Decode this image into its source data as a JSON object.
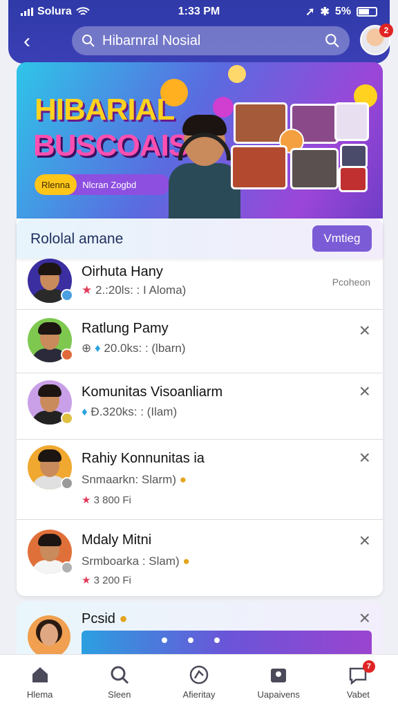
{
  "status": {
    "carrier": "Solura",
    "time": "1:33 PM",
    "battery": "5%"
  },
  "header": {
    "search_value": "Hibarnral Nosial",
    "avatar_badge": "2"
  },
  "banner": {
    "title_line1": "HIBARIAL",
    "title_line2": "BUSCOAIS",
    "pill_highlight": "Rlenna",
    "pill_text": "Nlcran Zogbd"
  },
  "panel": {
    "title": "Rololal amane",
    "action_label": "Vmtieg"
  },
  "rows": [
    {
      "name": "Oirhuta Hany",
      "meta": "2.:20ls: : I Aloma)",
      "side": "Pcoheon"
    },
    {
      "name": "Ratlung Pamy",
      "meta": "20.0ks: : (lbarn)"
    },
    {
      "name": "Komunitas Visoanliarm",
      "meta": "Đ.320ks: : (Ilam)"
    },
    {
      "name": "Rahiy Konnunitas ia",
      "meta": "Snmaarkn: Slarm)",
      "meta2": "3 800 Fi"
    },
    {
      "name": "Mdaly Mitni",
      "meta": "Srmboarka : Slam)",
      "meta2": "3 200 Fi"
    }
  ],
  "post": {
    "title": "Pcsid"
  },
  "nav": [
    {
      "label": "Hlema",
      "icon": "home-icon"
    },
    {
      "label": "Sleen",
      "icon": "search-icon"
    },
    {
      "label": "Afieritay",
      "icon": "activity-icon"
    },
    {
      "label": "Uapaivens",
      "icon": "groups-icon"
    },
    {
      "label": "Vabet",
      "icon": "chat-icon",
      "badge": "7"
    }
  ],
  "colors": {
    "accent": "#3b3fb5",
    "button": "#7b5cd6",
    "badge": "#e02424"
  }
}
